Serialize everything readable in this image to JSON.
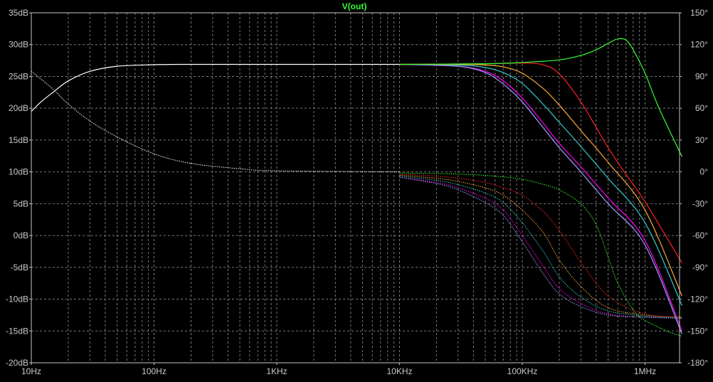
{
  "chart_data": {
    "type": "line",
    "title": "V(out)",
    "title_color": "#33ff33",
    "background": "#000000",
    "grid": true,
    "x_scale": "log",
    "x_range": [
      10,
      2000000
    ],
    "x_ticks": [
      {
        "value": 10,
        "label": "10Hz"
      },
      {
        "value": 100,
        "label": "100Hz"
      },
      {
        "value": 1000,
        "label": "1KHz"
      },
      {
        "value": 10000,
        "label": "10KHz"
      },
      {
        "value": 100000,
        "label": "100KHz"
      },
      {
        "value": 1000000,
        "label": "1MHz"
      }
    ],
    "y_left_range": [
      -20,
      35
    ],
    "y_left_ticks": [
      "35dB",
      "30dB",
      "25dB",
      "20dB",
      "15dB",
      "10dB",
      "5dB",
      "0dB",
      "-5dB",
      "-10dB",
      "-15dB",
      "-20dB"
    ],
    "y_right_range": [
      -180,
      150
    ],
    "y_right_ticks": [
      "150°",
      "120°",
      "90°",
      "60°",
      "30°",
      "0°",
      "-30°",
      "-60°",
      "-90°",
      "-120°",
      "-150°",
      "-180°"
    ],
    "series": [
      {
        "color": "#ffffff",
        "magnitude": [
          [
            10,
            19.5
          ],
          [
            12,
            21
          ],
          [
            15,
            22.5
          ],
          [
            20,
            24.3
          ],
          [
            30,
            25.8
          ],
          [
            50,
            26.6
          ],
          [
            100,
            26.85
          ],
          [
            200,
            26.9
          ],
          [
            1000,
            26.9
          ],
          [
            10000,
            26.9
          ]
        ],
        "phase": [
          [
            10,
            95
          ],
          [
            15,
            78
          ],
          [
            20,
            64
          ],
          [
            30,
            48
          ],
          [
            50,
            33
          ],
          [
            100,
            17
          ],
          [
            200,
            8
          ],
          [
            500,
            3
          ],
          [
            1000,
            1
          ],
          [
            10000,
            0
          ]
        ]
      },
      {
        "color": "#ff00ff",
        "magnitude": [
          [
            10000,
            26.9
          ],
          [
            30000,
            26.6
          ],
          [
            50000,
            25.8
          ],
          [
            70000,
            24.3
          ],
          [
            100000,
            21.6
          ],
          [
            150000,
            17.5
          ],
          [
            200000,
            14.5
          ],
          [
            300000,
            10.8
          ],
          [
            500000,
            5.9
          ],
          [
            1000000,
            -0.8
          ],
          [
            2000000,
            -15
          ]
        ],
        "phase": [
          [
            10000,
            -5
          ],
          [
            20000,
            -10
          ],
          [
            30000,
            -15
          ],
          [
            50000,
            -25
          ],
          [
            70000,
            -36
          ],
          [
            100000,
            -60
          ],
          [
            150000,
            -90
          ],
          [
            200000,
            -110
          ],
          [
            300000,
            -124
          ],
          [
            500000,
            -134
          ],
          [
            1000000,
            -137
          ],
          [
            2000000,
            -138
          ]
        ]
      },
      {
        "color": "#a0a0ff",
        "magnitude": [
          [
            10000,
            26.9
          ],
          [
            30000,
            26.6
          ],
          [
            50000,
            25.6
          ],
          [
            70000,
            23.8
          ],
          [
            100000,
            21
          ],
          [
            150000,
            16.8
          ],
          [
            200000,
            13.8
          ],
          [
            300000,
            10
          ],
          [
            500000,
            5
          ],
          [
            1000000,
            -1.5
          ],
          [
            2000000,
            -15.5
          ]
        ],
        "phase": [
          [
            10000,
            -5
          ],
          [
            20000,
            -11
          ],
          [
            30000,
            -17
          ],
          [
            50000,
            -29
          ],
          [
            70000,
            -41
          ],
          [
            100000,
            -66
          ],
          [
            150000,
            -97
          ],
          [
            200000,
            -115
          ],
          [
            300000,
            -127
          ],
          [
            500000,
            -135
          ],
          [
            1000000,
            -137
          ],
          [
            2000000,
            -138
          ]
        ]
      },
      {
        "color": "#33cccc",
        "magnitude": [
          [
            10000,
            26.9
          ],
          [
            30000,
            26.8
          ],
          [
            50000,
            26.4
          ],
          [
            70000,
            25.6
          ],
          [
            100000,
            23.9
          ],
          [
            150000,
            20.5
          ],
          [
            200000,
            17.8
          ],
          [
            300000,
            14
          ],
          [
            500000,
            9
          ],
          [
            1000000,
            2
          ],
          [
            2000000,
            -11
          ]
        ],
        "phase": [
          [
            10000,
            -4
          ],
          [
            20000,
            -8
          ],
          [
            30000,
            -12
          ],
          [
            50000,
            -20
          ],
          [
            70000,
            -29
          ],
          [
            100000,
            -48
          ],
          [
            150000,
            -76
          ],
          [
            200000,
            -99
          ],
          [
            300000,
            -118
          ],
          [
            500000,
            -131
          ],
          [
            1000000,
            -136
          ],
          [
            2000000,
            -138
          ]
        ]
      },
      {
        "color": "#ffaa33",
        "magnitude": [
          [
            10000,
            26.9
          ],
          [
            30000,
            26.9
          ],
          [
            50000,
            26.8
          ],
          [
            70000,
            26.5
          ],
          [
            100000,
            25.5
          ],
          [
            150000,
            23
          ],
          [
            200000,
            20.5
          ],
          [
            300000,
            16.5
          ],
          [
            500000,
            11.5
          ],
          [
            1000000,
            4
          ],
          [
            2000000,
            -9.5
          ]
        ],
        "phase": [
          [
            10000,
            -3
          ],
          [
            20000,
            -6
          ],
          [
            30000,
            -9
          ],
          [
            50000,
            -15
          ],
          [
            70000,
            -22
          ],
          [
            100000,
            -36
          ],
          [
            150000,
            -58
          ],
          [
            200000,
            -83
          ],
          [
            300000,
            -108
          ],
          [
            500000,
            -128
          ],
          [
            1000000,
            -135
          ],
          [
            2000000,
            -137
          ]
        ]
      },
      {
        "color": "#ff2222",
        "magnitude": [
          [
            10000,
            26.9
          ],
          [
            50000,
            27
          ],
          [
            100000,
            27.1
          ],
          [
            150000,
            26.8
          ],
          [
            200000,
            25.4
          ],
          [
            300000,
            21
          ],
          [
            500000,
            13.8
          ],
          [
            700000,
            9.6
          ],
          [
            1000000,
            5.3
          ],
          [
            2000000,
            -4.3
          ]
        ],
        "phase": [
          [
            10000,
            -2
          ],
          [
            20000,
            -4
          ],
          [
            30000,
            -6
          ],
          [
            50000,
            -10
          ],
          [
            70000,
            -15
          ],
          [
            100000,
            -22
          ],
          [
            150000,
            -38
          ],
          [
            200000,
            -55
          ],
          [
            300000,
            -85
          ],
          [
            500000,
            -117
          ],
          [
            1000000,
            -134
          ],
          [
            2000000,
            -137
          ]
        ]
      },
      {
        "color": "#33ff33",
        "magnitude": [
          [
            10000,
            26.9
          ],
          [
            50000,
            27
          ],
          [
            100000,
            27.2
          ],
          [
            200000,
            27.6
          ],
          [
            300000,
            28.3
          ],
          [
            400000,
            29.2
          ],
          [
            500000,
            30.2
          ],
          [
            600000,
            30.9
          ],
          [
            700000,
            30.7
          ],
          [
            800000,
            29.2
          ],
          [
            1000000,
            25.5
          ],
          [
            1300000,
            20
          ],
          [
            2000000,
            12.4
          ]
        ],
        "phase": [
          [
            10000,
            -1
          ],
          [
            30000,
            -2
          ],
          [
            60000,
            -4
          ],
          [
            100000,
            -7
          ],
          [
            150000,
            -12
          ],
          [
            200000,
            -17
          ],
          [
            300000,
            -30
          ],
          [
            400000,
            -50
          ],
          [
            500000,
            -80
          ],
          [
            600000,
            -105
          ],
          [
            800000,
            -130
          ],
          [
            1000000,
            -140
          ],
          [
            1500000,
            -150
          ],
          [
            2000000,
            -155
          ]
        ]
      }
    ]
  }
}
